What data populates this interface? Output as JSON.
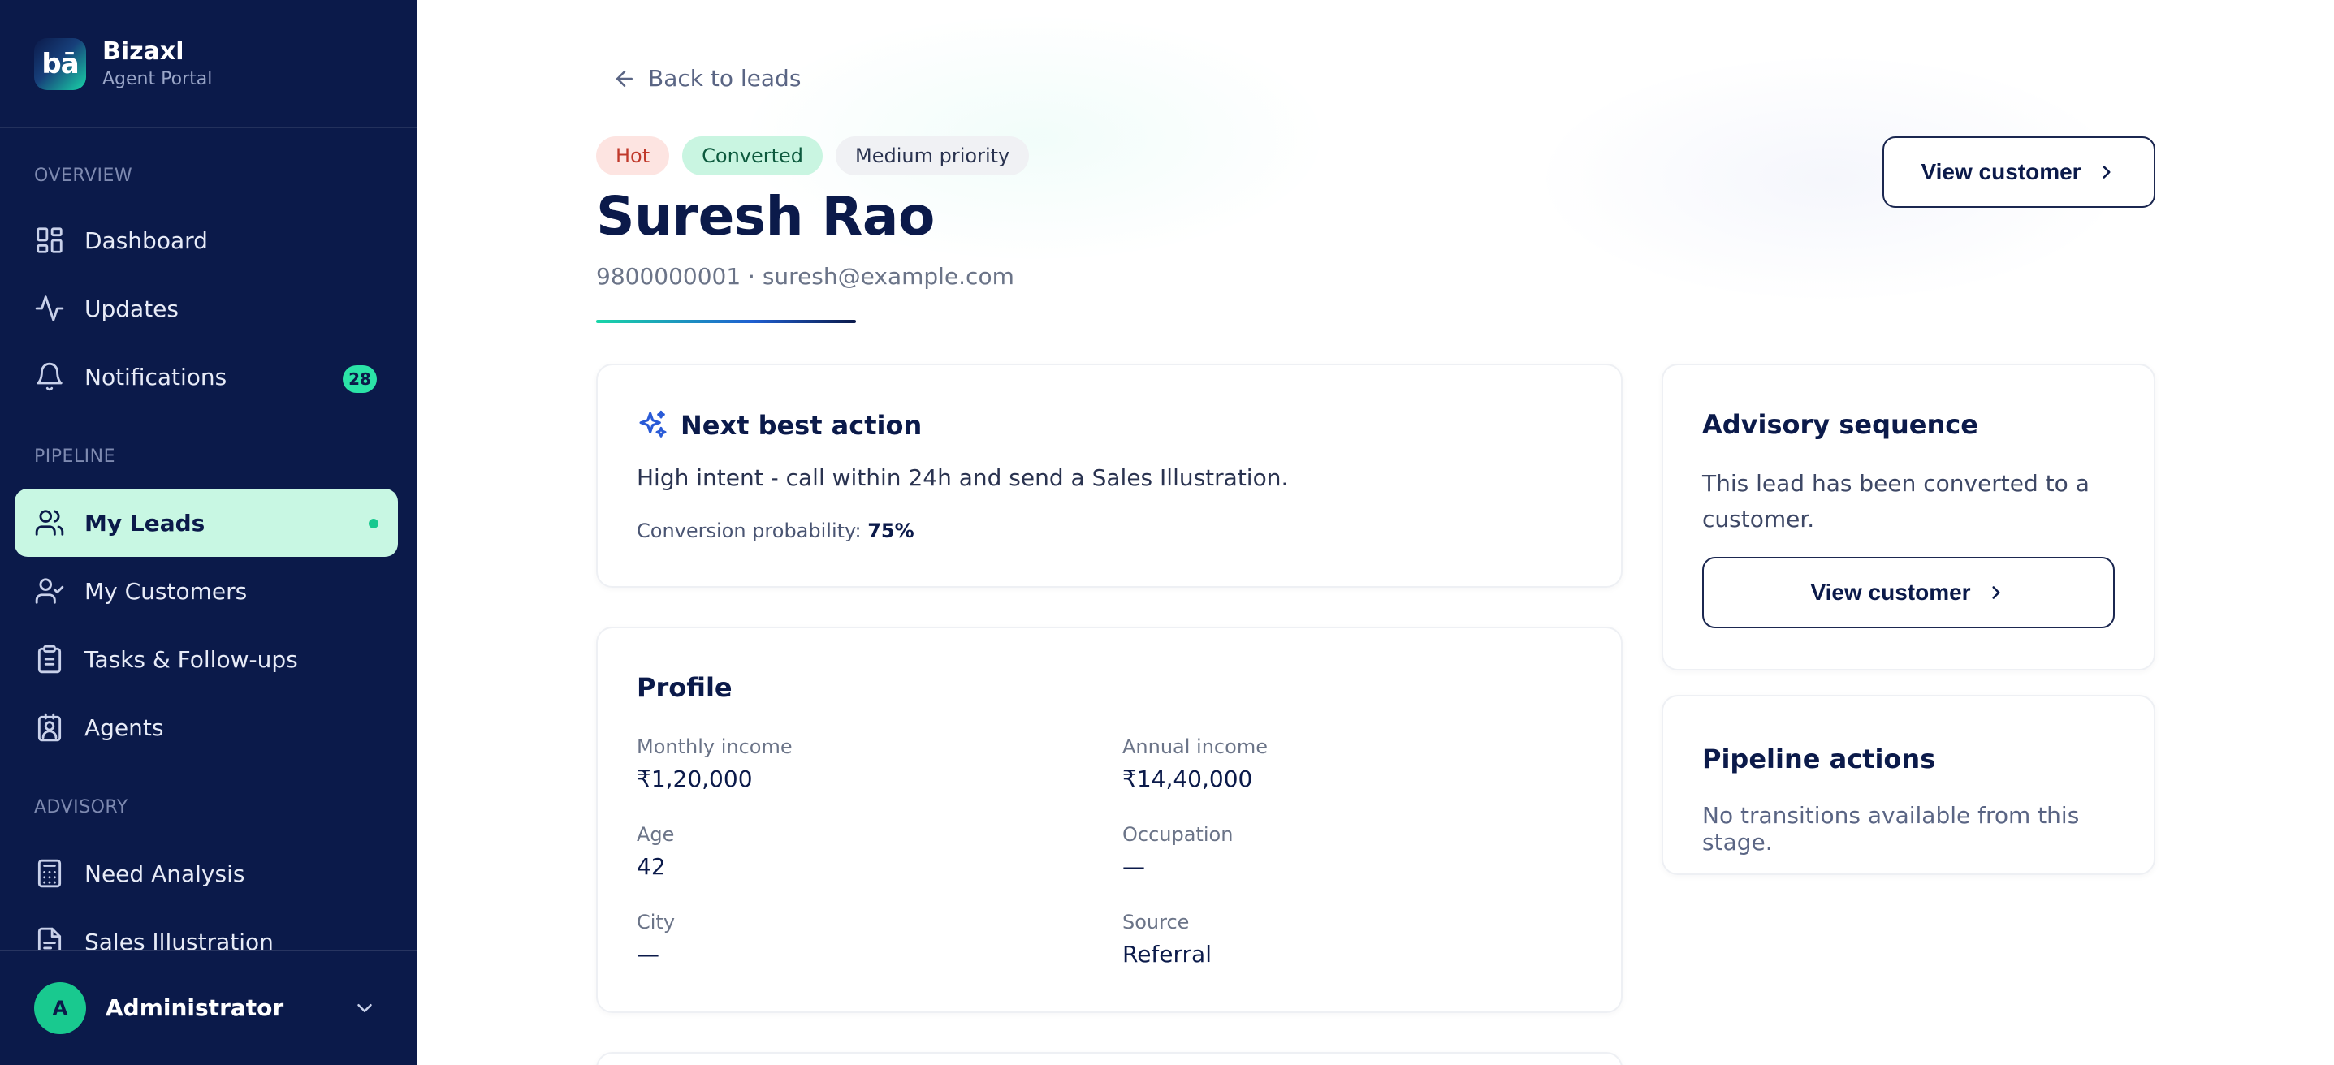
{
  "brand": {
    "logo_text": "bā",
    "name": "Bizaxl",
    "subtitle": "Agent Portal"
  },
  "sidebar": {
    "sections": [
      {
        "title": "OVERVIEW"
      },
      {
        "title": "PIPELINE"
      },
      {
        "title": "ADVISORY"
      }
    ],
    "items": [
      {
        "label": "Dashboard",
        "icon": "dashboard-icon"
      },
      {
        "label": "Updates",
        "icon": "activity-icon"
      },
      {
        "label": "Notifications",
        "icon": "bell-icon",
        "badge": "28"
      },
      {
        "label": "My Leads",
        "icon": "users-icon",
        "active": true
      },
      {
        "label": "My Customers",
        "icon": "user-check-icon"
      },
      {
        "label": "Tasks & Follow-ups",
        "icon": "clipboard-icon"
      },
      {
        "label": "Agents",
        "icon": "badge-icon"
      },
      {
        "label": "Need Analysis",
        "icon": "calculator-icon"
      },
      {
        "label": "Sales Illustration",
        "icon": "document-icon"
      }
    ],
    "user": {
      "initial": "A",
      "name": "Administrator"
    }
  },
  "header": {
    "back_label": "Back to leads",
    "pills": {
      "temperature": "Hot",
      "status": "Converted",
      "priority": "Medium priority"
    },
    "name": "Suresh Rao",
    "contact": "9800000001 · suresh@example.com",
    "view_customer_label": "View customer"
  },
  "next_best_action": {
    "title": "Next best action",
    "text": "High intent - call within 24h and send a Sales Illustration.",
    "probability_label": "Conversion probability:",
    "probability_value": "75%"
  },
  "profile": {
    "title": "Profile",
    "fields": [
      {
        "label": "Monthly income",
        "value": "₹1,20,000"
      },
      {
        "label": "Annual income",
        "value": "₹14,40,000"
      },
      {
        "label": "Age",
        "value": "42"
      },
      {
        "label": "Occupation",
        "value": "—"
      },
      {
        "label": "City",
        "value": "—"
      },
      {
        "label": "Source",
        "value": "Referral"
      }
    ]
  },
  "advisory": {
    "title": "Advisory sequence",
    "text": "This lead has been converted to a customer.",
    "button_label": "View customer"
  },
  "pipeline_actions": {
    "title": "Pipeline actions",
    "text": "No transitions available from this stage."
  },
  "colors": {
    "sidebar_bg": "#0b1a4a",
    "accent": "#19d6a8",
    "active_item_bg": "#c8f7e3",
    "hot_pill_bg": "#fde4e1",
    "converted_pill_bg": "#c9f5e1"
  }
}
